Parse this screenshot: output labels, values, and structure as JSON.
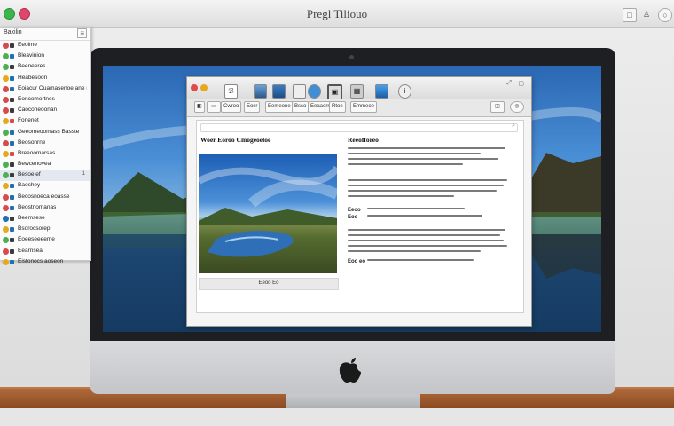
{
  "window": {
    "title": "Pregl Tiliouo"
  },
  "sidebar": {
    "header": "Baxilin",
    "items": [
      {
        "label": "Eeolme",
        "dot": "#d64b4b",
        "mini": "#3b3b3b"
      },
      {
        "label": "Bleavinion",
        "dot": "#4caf50",
        "mini": "#1f6fb3"
      },
      {
        "label": "Beeneeres",
        "dot": "#4caf50",
        "mini": "#3b3b3b"
      },
      {
        "label": "Heabesoon",
        "dot": "#e6a81c",
        "mini": "#1f6fb3"
      },
      {
        "label": "Eoiacur Ouamasenoe ane meacose",
        "dot": "#d64b4b",
        "mini": "#1f6fb3"
      },
      {
        "label": "Eoncomortnes",
        "dot": "#d64b4b",
        "mini": "#3b3b3b"
      },
      {
        "label": "Caoconeoonan",
        "dot": "#d64b4b",
        "mini": "#3b3b3b"
      },
      {
        "label": "Fonenet",
        "dot": "#e6a81c",
        "mini": "#d64b4b"
      },
      {
        "label": "Geeomeoomass Basste",
        "dot": "#4caf50",
        "mini": "#1f6fb3"
      },
      {
        "label": "Beosonrne",
        "dot": "#d64b4b",
        "mini": "#1f6fb3"
      },
      {
        "label": "Breeoomarsas",
        "dot": "#e6a81c",
        "mini": "#d64b4b"
      },
      {
        "label": "Bewcenovea",
        "dot": "#4caf50",
        "mini": "#3b3b3b"
      },
      {
        "label": "Besoe ef",
        "dot": "#4caf50",
        "mini": "#3b3b3b",
        "selected": true,
        "count": "1"
      },
      {
        "label": "Baoshey",
        "dot": "#e6a81c",
        "mini": "#1f6fb3"
      },
      {
        "label": "Becosnoeca eoasse",
        "dot": "#d64b4b",
        "mini": "#1f6fb3"
      },
      {
        "label": "Beostnomanas",
        "dot": "#d64b4b",
        "mini": "#1f6fb3"
      },
      {
        "label": "Beemsese",
        "dot": "#1f6fb3",
        "mini": "#3b3b3b"
      },
      {
        "label": "Bsorocsorep",
        "dot": "#e6a81c",
        "mini": "#1f6fb3"
      },
      {
        "label": "Eoeeseeeeme",
        "dot": "#4caf50",
        "mini": "#3b3b3b"
      },
      {
        "label": "Eearrisea",
        "dot": "#d64b4b",
        "mini": "#3b3b3b"
      },
      {
        "label": "Eistonocs aoseon",
        "dot": "#e6a81c",
        "mini": "#1f6fb3"
      }
    ]
  },
  "app": {
    "toolbar_buttons": [
      "Cwroo",
      "Eosr",
      "Eemeone",
      "Bsso",
      "Eeaaerr",
      "Rtoe",
      "Emmeoe"
    ],
    "doc": {
      "left_title": "Woer Eoroo Cmogeoeloe",
      "caption": "Eeoo Eo",
      "right_heading": "Reeofforeo",
      "para_label_1": "Eeoo",
      "para_label_2": "Eoo",
      "foot_label": "Eoo eo"
    }
  },
  "colors": {
    "accent": "#2b67b3",
    "wood": "#9b5a2c"
  }
}
